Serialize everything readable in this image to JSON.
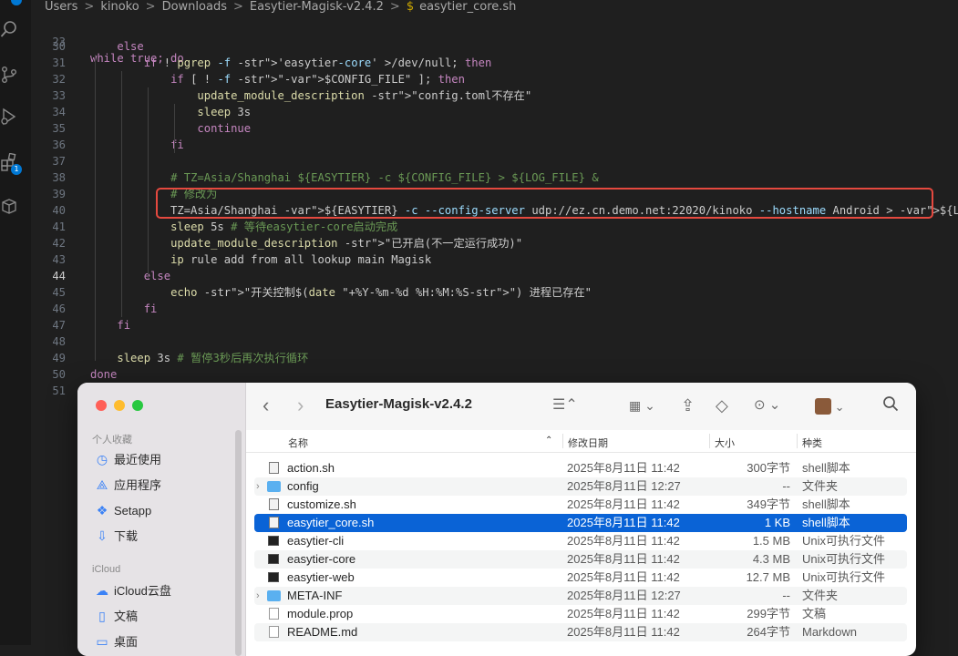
{
  "breadcrumb": {
    "parts": [
      "Users",
      "kinoko",
      "Downloads",
      "Easytier-Magisk-v2.4.2"
    ],
    "separator": ">",
    "file_icon": "$",
    "file": "easytier_core.sh"
  },
  "activity_bar": {
    "icons": [
      "search-icon",
      "source-control-icon",
      "run-debug-icon",
      "extensions-icon",
      "remote-explorer-icon"
    ],
    "extensions_badge": "1"
  },
  "editor": {
    "sticky_line": {
      "number": "23",
      "text": "while true; do"
    },
    "active_line": "44",
    "lines": [
      {
        "number": "30",
        "text": "    else"
      },
      {
        "number": "31",
        "text": "        if ! pgrep -f 'easytier-core' >/dev/null; then"
      },
      {
        "number": "32",
        "text": "            if [ ! -f \"$CONFIG_FILE\" ]; then"
      },
      {
        "number": "33",
        "text": "                update_module_description \"config.toml不存在\""
      },
      {
        "number": "34",
        "text": "                sleep 3s"
      },
      {
        "number": "35",
        "text": "                continue"
      },
      {
        "number": "36",
        "text": "            fi"
      },
      {
        "number": "37",
        "text": ""
      },
      {
        "number": "38",
        "text": "            # TZ=Asia/Shanghai ${EASYTIER} -c ${CONFIG_FILE} > ${LOG_FILE} &"
      },
      {
        "number": "39",
        "text": "            # 修改为"
      },
      {
        "number": "40",
        "text": "            TZ=Asia/Shanghai ${EASYTIER} -c --config-server udp://ez.cn.demo.net:22020/kinoko --hostname Android > ${LOG_FILE} &"
      },
      {
        "number": "41",
        "text": "            sleep 5s # 等待easytier-core启动完成"
      },
      {
        "number": "42",
        "text": "            update_module_description \"已开启(不一定运行成功)\""
      },
      {
        "number": "43",
        "text": "            ip rule add from all lookup main Magisk"
      },
      {
        "number": "44",
        "text": "        else"
      },
      {
        "number": "45",
        "text": "            echo \"开关控制$(date \"+%Y-%m-%d %H:%M:%S\") 进程已存在\""
      },
      {
        "number": "46",
        "text": "        fi"
      },
      {
        "number": "47",
        "text": "    fi"
      },
      {
        "number": "48",
        "text": ""
      },
      {
        "number": "49",
        "text": "    sleep 3s # 暂停3秒后再次执行循环"
      },
      {
        "number": "50",
        "text": "done"
      },
      {
        "number": "51",
        "text": ""
      }
    ]
  },
  "finder": {
    "title": "Easytier-Magisk-v2.4.2",
    "sidebar": {
      "favorites_header": "个人收藏",
      "favorites": [
        {
          "label": "最近使用",
          "icon": "clock-icon"
        },
        {
          "label": "应用程序",
          "icon": "apps-icon"
        },
        {
          "label": "Setapp",
          "icon": "setapp-icon"
        },
        {
          "label": "下载",
          "icon": "download-icon"
        }
      ],
      "icloud_header": "iCloud",
      "icloud": [
        {
          "label": "iCloud云盘",
          "icon": "cloud-icon"
        },
        {
          "label": "文稿",
          "icon": "document-icon"
        },
        {
          "label": "桌面",
          "icon": "desktop-icon"
        }
      ]
    },
    "columns": {
      "name": "名称",
      "date": "修改日期",
      "size": "大小",
      "kind": "种类"
    },
    "files": [
      {
        "name": "action.sh",
        "date": "2025年8月11日 11:42",
        "size": "300字节",
        "kind": "shell脚本",
        "icon": "shell-doc",
        "folder": false
      },
      {
        "name": "config",
        "date": "2025年8月11日 12:27",
        "size": "--",
        "kind": "文件夹",
        "icon": "folder",
        "folder": true
      },
      {
        "name": "customize.sh",
        "date": "2025年8月11日 11:42",
        "size": "349字节",
        "kind": "shell脚本",
        "icon": "shell-doc",
        "folder": false
      },
      {
        "name": "easytier_core.sh",
        "date": "2025年8月11日 11:42",
        "size": "1 KB",
        "kind": "shell脚本",
        "icon": "shell-doc",
        "folder": false,
        "selected": true
      },
      {
        "name": "easytier-cli",
        "date": "2025年8月11日 11:42",
        "size": "1.5 MB",
        "kind": "Unix可执行文件",
        "icon": "exec",
        "folder": false
      },
      {
        "name": "easytier-core",
        "date": "2025年8月11日 11:42",
        "size": "4.3 MB",
        "kind": "Unix可执行文件",
        "icon": "exec",
        "folder": false
      },
      {
        "name": "easytier-web",
        "date": "2025年8月11日 11:42",
        "size": "12.7 MB",
        "kind": "Unix可执行文件",
        "icon": "exec",
        "folder": false
      },
      {
        "name": "META-INF",
        "date": "2025年8月11日 12:27",
        "size": "--",
        "kind": "文件夹",
        "icon": "folder",
        "folder": true
      },
      {
        "name": "module.prop",
        "date": "2025年8月11日 11:42",
        "size": "299字节",
        "kind": "文稿",
        "icon": "doc",
        "folder": false
      },
      {
        "name": "README.md",
        "date": "2025年8月11日 11:42",
        "size": "264字节",
        "kind": "Markdown",
        "icon": "doc",
        "folder": false
      }
    ]
  },
  "colors": {
    "highlight_border": "#e5493f",
    "selection": "#0a63d6",
    "folder": "#5ab0f0"
  }
}
